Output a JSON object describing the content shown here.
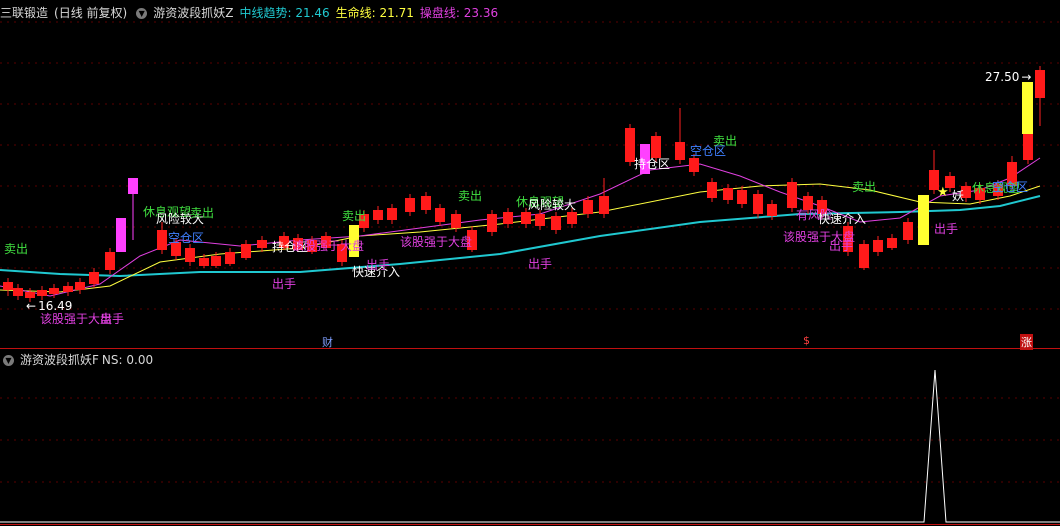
{
  "header": {
    "stock_name": "三联锻造",
    "period": "(日线 前复权)",
    "indicator_name": "游资波段抓妖Z",
    "mid_trend_label": "中线趋势:",
    "mid_trend_value": "21.46",
    "life_line_label": "生命线:",
    "life_line_value": "21.71",
    "trade_line_label": "操盘线:",
    "trade_line_value": "23.36",
    "colors": {
      "mid_trend": "#20c8d0",
      "life_line": "#ffff40",
      "trade_line": "#e040e0"
    }
  },
  "sub_header": {
    "indicator_name": "游资波段抓妖F",
    "ns_label": "NS:",
    "ns_value": "0.00"
  },
  "price_labels": {
    "high": "27.50",
    "low": "16.49",
    "low_arrow": "←",
    "high_arrow": "→"
  },
  "markers": {
    "cai": "财",
    "s": "$",
    "zhang": "涨",
    "star": "★",
    "yao": "妖"
  },
  "signals": [
    {
      "text": "卖出",
      "color": "#40e040"
    },
    {
      "text": "该股强于大盘",
      "color": "#e040e0"
    },
    {
      "text": "出手",
      "color": "#e040e0"
    },
    {
      "text": "休息观望",
      "color": "#40e040"
    },
    {
      "text": "风险较大",
      "color": "#ffffff"
    },
    {
      "text": "卖出",
      "color": "#40e040"
    },
    {
      "text": "空仓区",
      "color": "#4080ff"
    },
    {
      "text": "持仓区",
      "color": "#ffffff"
    },
    {
      "text": "该股强于大盘",
      "color": "#e040e0"
    },
    {
      "text": "出手",
      "color": "#e040e0"
    },
    {
      "text": "卖出",
      "color": "#40e040"
    },
    {
      "text": "快速介入",
      "color": "#ffffff"
    },
    {
      "text": "出手",
      "color": "#e040e0"
    },
    {
      "text": "该股强于大盘",
      "color": "#e040e0"
    },
    {
      "text": "卖出",
      "color": "#40e040"
    },
    {
      "text": "休息观望",
      "color": "#40e040"
    },
    {
      "text": "风险较大",
      "color": "#ffffff"
    },
    {
      "text": "出手",
      "color": "#e040e0"
    },
    {
      "text": "卖出",
      "color": "#40e040"
    },
    {
      "text": "持仓区",
      "color": "#ffffff"
    },
    {
      "text": "空仓区",
      "color": "#4080ff"
    },
    {
      "text": "卖出",
      "color": "#40e040"
    },
    {
      "text": "有风险",
      "color": "#e040e0"
    },
    {
      "text": "快速介入",
      "color": "#ffffff"
    },
    {
      "text": "该股强于大盘",
      "color": "#e040e0"
    },
    {
      "text": "出手",
      "color": "#e040e0"
    },
    {
      "text": "出手",
      "color": "#e040e0"
    },
    {
      "text": "休息观望",
      "color": "#40e040"
    },
    {
      "text": "空仓区",
      "color": "#4080ff"
    }
  ]
}
